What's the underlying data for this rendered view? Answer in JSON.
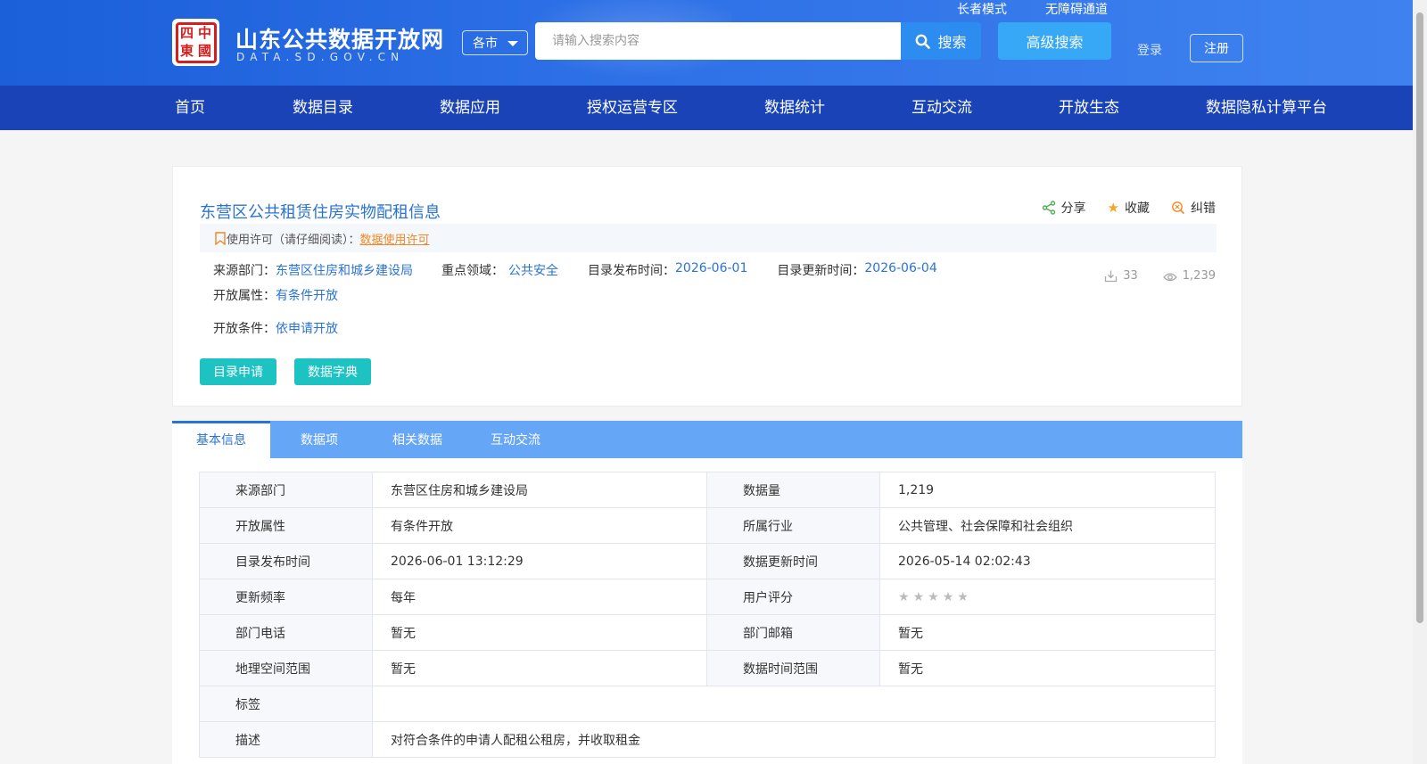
{
  "header": {
    "site_title": "山东公共数据开放网",
    "site_domain": "DATA.SD.GOV.CN",
    "logo_seal_chars": [
      "中",
      "四",
      "國",
      "東"
    ],
    "city_select": "各市",
    "search_placeholder": "请输入搜索内容",
    "search_label": "搜索",
    "advanced_search_label": "高级搜索",
    "elder_mode": "长者模式",
    "accessible_channel": "无障碍通道",
    "login": "登录",
    "register": "注册"
  },
  "nav": {
    "items": [
      {
        "label": "首页"
      },
      {
        "label": "数据目录"
      },
      {
        "label": "数据应用"
      },
      {
        "label": "授权运营专区"
      },
      {
        "label": "数据统计"
      },
      {
        "label": "互动交流"
      },
      {
        "label": "开放生态"
      },
      {
        "label": "数据隐私计算平台"
      }
    ]
  },
  "dataset": {
    "title": "东营区公共租赁住房实物配租信息",
    "actions": {
      "share": "分享",
      "favorite": "收藏",
      "report_error": "纠错"
    },
    "license": {
      "label": "使用许可（请仔细阅读）：",
      "link": "数据使用许可"
    },
    "meta": {
      "source_dept_label": "来源部门：",
      "source_dept": "东营区住房和城乡建设局",
      "key_domain_label": "重点领域：",
      "key_domain": "公共安全",
      "publish_time_label": "目录发布时间：",
      "publish_time": "2026-06-01",
      "update_time_label": "目录更新时间：",
      "update_time": "2026-06-04",
      "open_attr_label": "开放属性：",
      "open_attr": "有条件开放",
      "open_cond_label": "开放条件：",
      "open_cond": "依申请开放"
    },
    "stats": {
      "downloads": "33",
      "views": "1,239"
    },
    "buttons": {
      "apply": "目录申请",
      "dictionary": "数据字典"
    }
  },
  "tabs": {
    "items": [
      {
        "label": "基本信息",
        "active": true
      },
      {
        "label": "数据项"
      },
      {
        "label": "相关数据"
      },
      {
        "label": "互动交流"
      }
    ]
  },
  "info_table": {
    "rows": [
      {
        "l1": "来源部门",
        "v1": "东营区住房和城乡建设局",
        "l2": "数据量",
        "v2": "1,219"
      },
      {
        "l1": "开放属性",
        "v1": "有条件开放",
        "l2": "所属行业",
        "v2": "公共管理、社会保障和社会组织"
      },
      {
        "l1": "目录发布时间",
        "v1": "2026-06-01 13:12:29",
        "l2": "数据更新时间",
        "v2": "2026-05-14 02:02:43"
      },
      {
        "l1": "更新频率",
        "v1": "每年",
        "l2": "用户评分",
        "rating": 0,
        "rating_max": 5
      },
      {
        "l1": "部门电话",
        "v1": "暂无",
        "l2": "部门邮箱",
        "v2": "暂无"
      },
      {
        "l1": "地理空间范围",
        "v1": "暂无",
        "l2": "数据时间范围",
        "v2": "暂无"
      }
    ],
    "tags_label": "标签",
    "tags_value": "",
    "desc_label": "描述",
    "desc_value": "对符合条件的申请人配租公租房，并收取租金"
  },
  "colors": {
    "header_blue": "#2c6fe6",
    "nav_blue": "#1a43b8",
    "link_blue": "#2a73d6",
    "teal": "#1dc3c3",
    "license_orange": "#f08a24",
    "tab_bar": "#66a6f7"
  }
}
